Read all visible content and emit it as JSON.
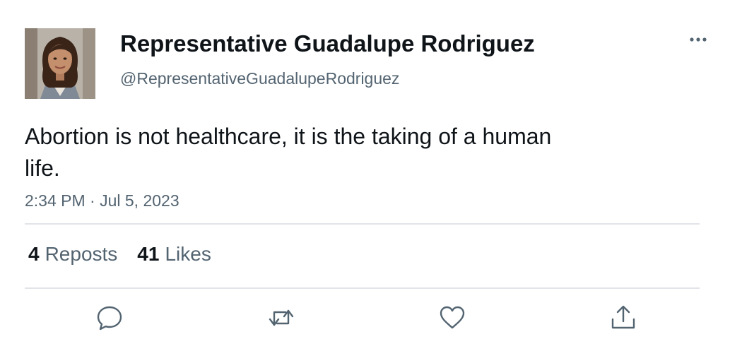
{
  "author": {
    "name": "Representative Guadalupe Rodriguez",
    "handle": "@RepresentativeGuadalupeRodriguez"
  },
  "tweet": {
    "text": "Abortion is not healthcare, it is the taking of a human life.",
    "timestamp": "2:34 PM · Jul 5, 2023"
  },
  "stats": {
    "reposts_count": "4",
    "reposts_label": "Reposts",
    "likes_count": "41",
    "likes_label": "Likes"
  },
  "icons": {
    "more": "more-dots-icon",
    "reply": "reply-icon",
    "repost": "repost-icon",
    "like": "heart-icon",
    "share": "share-icon"
  },
  "colors": {
    "text": "#0f1419",
    "secondary": "#536471",
    "divider": "#e1e4e8",
    "icon": "#536471"
  }
}
